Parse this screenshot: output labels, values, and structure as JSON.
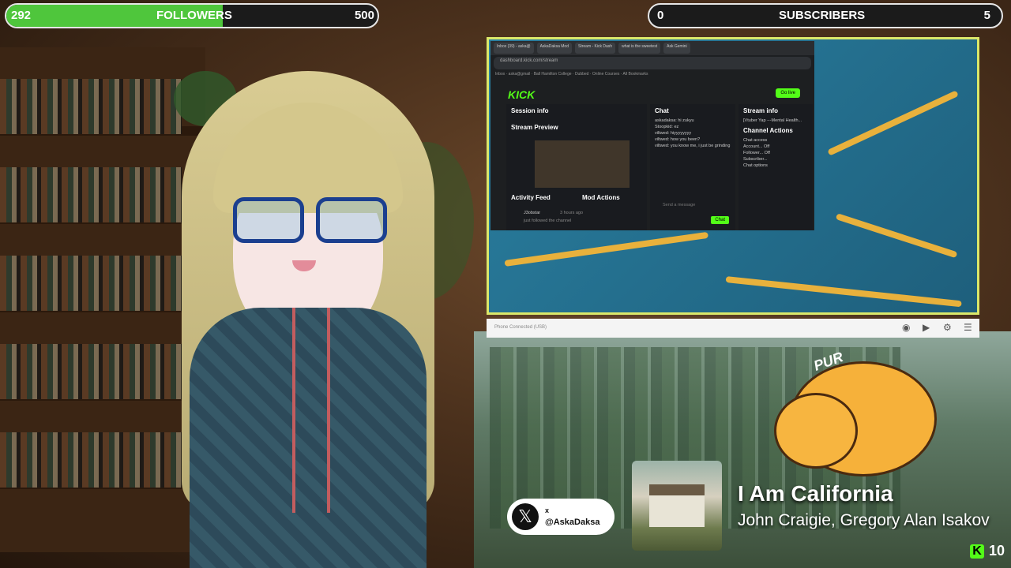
{
  "followers_bar": {
    "current": "292",
    "label": "FOLLOWERS",
    "goal": "500",
    "progress": 0.584,
    "color": "#4fc63c"
  },
  "subscribers_bar": {
    "current": "0",
    "label": "SUBSCRIBERS",
    "goal": "5",
    "progress": 0.0
  },
  "browser": {
    "tabs": [
      "Inbox (39) - aska@",
      "AskaDaksa Mod",
      "Stream - Kick Dash",
      "what is the sweetest",
      "Ask Gemini"
    ],
    "address": "dashboard.kick.com/stream",
    "bookmarks": "Inbox · aska@gmail · Ball Hamilton College · Dubbed · Online Courses · All Bookmarks",
    "logo": "KICK",
    "go_live": "Go live",
    "session_info": "Session info",
    "stream_preview": "Stream Preview",
    "activity_feed": "Activity Feed",
    "mod_actions": "Mod Actions",
    "activity_user": "J3obstar",
    "activity_text": "just followed the channel",
    "activity_time": "3 hours ago",
    "chat_title": "Chat",
    "chat_lines": [
      "askadaksa: hi  zukyu",
      "Stoopkid: ez",
      "viltwed: hiyyyyyyyy",
      "viltwed: how you been?",
      "viltwed: you know me, i just be grinding"
    ],
    "send_placeholder": "Send a message",
    "chat_button": "Chat",
    "stream_info": "Stream info",
    "stream_info_text": "[Vtuber Yap ---Mental Health...",
    "channel_actions": "Channel Actions",
    "chat_access": "Chat access",
    "account_age": "Account...",
    "account_age_value": "Off",
    "followers_only": "Follower...",
    "followers_only_value": "Off",
    "subscribers_only": "Subscriber...",
    "chat_options": "Chat options"
  },
  "camera_bar": {
    "label": "Phone Connected (USB)"
  },
  "cat": {
    "text": "PUR"
  },
  "now_playing": {
    "title": "I Am California",
    "artist": "John Craigie, Gregory Alan Isakov"
  },
  "social": {
    "platform": "x",
    "handle": "@AskaDaksa"
  },
  "kick_viewers": {
    "count": "10"
  }
}
